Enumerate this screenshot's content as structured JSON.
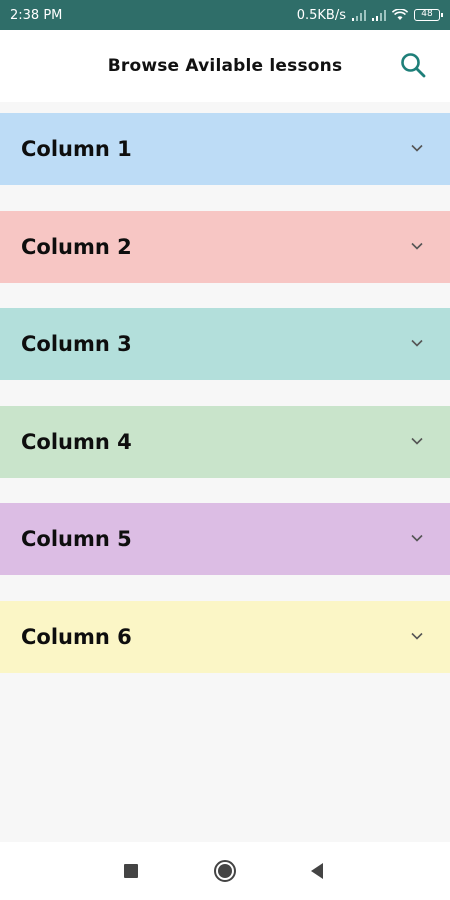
{
  "status_bar": {
    "time": "2:38 PM",
    "network_speed": "0.5KB/s",
    "battery_level": "48",
    "icons": [
      "signal-icon",
      "signal-icon",
      "wifi-icon",
      "battery-icon"
    ]
  },
  "header": {
    "title": "Browse Avilable lessons",
    "search_icon": "search-icon",
    "accent_color": "#1e7f79"
  },
  "columns": [
    {
      "label": "Column 1",
      "color": "#bddcf6"
    },
    {
      "label": "Column 2",
      "color": "#f7c6c4"
    },
    {
      "label": "Column 3",
      "color": "#b3dfdb"
    },
    {
      "label": "Column 4",
      "color": "#c9e4cb"
    },
    {
      "label": "Column 5",
      "color": "#dcbde4"
    },
    {
      "label": "Column 6",
      "color": "#fbf6c6"
    }
  ],
  "nav_bar": {
    "icons": [
      "recent-apps-icon",
      "home-icon",
      "back-icon"
    ]
  }
}
